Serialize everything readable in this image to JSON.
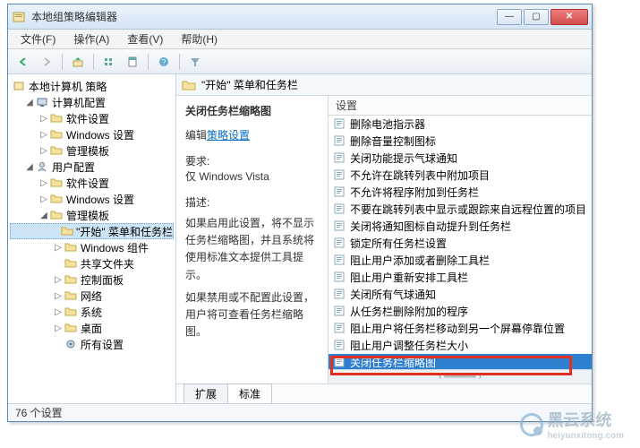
{
  "window": {
    "title": "本地组策略编辑器"
  },
  "menubar": [
    {
      "label": "文件(F)"
    },
    {
      "label": "操作(A)"
    },
    {
      "label": "查看(V)"
    },
    {
      "label": "帮助(H)"
    }
  ],
  "tree": {
    "root": "本地计算机 策略",
    "nodes": [
      {
        "level": 1,
        "twist": "◢",
        "label": "计算机配置",
        "icon": "computer"
      },
      {
        "level": 2,
        "twist": "▷",
        "label": "软件设置",
        "icon": "folder"
      },
      {
        "level": 2,
        "twist": "▷",
        "label": "Windows 设置",
        "icon": "folder"
      },
      {
        "level": 2,
        "twist": "▷",
        "label": "管理模板",
        "icon": "folder"
      },
      {
        "level": 1,
        "twist": "◢",
        "label": "用户配置",
        "icon": "user"
      },
      {
        "level": 2,
        "twist": "▷",
        "label": "软件设置",
        "icon": "folder"
      },
      {
        "level": 2,
        "twist": "▷",
        "label": "Windows 设置",
        "icon": "folder"
      },
      {
        "level": 2,
        "twist": "◢",
        "label": "管理模板",
        "icon": "folder"
      },
      {
        "level": 3,
        "twist": "",
        "label": "\"开始\" 菜单和任务栏",
        "icon": "folder",
        "sel": true
      },
      {
        "level": 3,
        "twist": "▷",
        "label": "Windows 组件",
        "icon": "folder"
      },
      {
        "level": 3,
        "twist": "",
        "label": "共享文件夹",
        "icon": "folder"
      },
      {
        "level": 3,
        "twist": "▷",
        "label": "控制面板",
        "icon": "folder"
      },
      {
        "level": 3,
        "twist": "▷",
        "label": "网络",
        "icon": "folder"
      },
      {
        "level": 3,
        "twist": "▷",
        "label": "系统",
        "icon": "folder"
      },
      {
        "level": 3,
        "twist": "▷",
        "label": "桌面",
        "icon": "folder"
      },
      {
        "level": 3,
        "twist": "",
        "label": "所有设置",
        "icon": "settings"
      }
    ]
  },
  "content": {
    "heading": "\"开始\" 菜单和任务栏",
    "detail": {
      "title": "关闭任务栏缩略图",
      "edit_prefix": "编辑",
      "edit_link": "策略设置",
      "req_label": "要求:",
      "req_value": "仅 Windows Vista",
      "desc_label": "描述:",
      "desc_p1": "如果启用此设置，将不显示任务栏缩略图，并且系统将使用标准文本提供工具提示。",
      "desc_p2": "如果禁用或不配置此设置，用户将可查看任务栏缩略图。"
    },
    "list_header": "设置",
    "list": [
      "删除电池指示器",
      "删除音量控制图标",
      "关闭功能提示气球通知",
      "不允许在跳转列表中附加项目",
      "不允许将程序附加到任务栏",
      "不要在跳转列表中显示或跟踪来自远程位置的项目",
      "关闭将通知图标自动提升到任务栏",
      "锁定所有任务栏设置",
      "阻止用户添加或者删除工具栏",
      "阻止用户重新安排工具栏",
      "关闭所有气球通知",
      "从任务栏删除附加的程序",
      "阻止用户将任务栏移动到另一个屏幕停靠位置",
      "阻止用户调整任务栏大小",
      "关闭任务栏缩略图"
    ],
    "selected_index": 14,
    "tabs": [
      {
        "label": "扩展",
        "active": false
      },
      {
        "label": "标准",
        "active": true
      }
    ]
  },
  "statusbar": "76 个设置",
  "watermark": {
    "main": "黑云系统",
    "sub": "heiyunxitong.com"
  }
}
